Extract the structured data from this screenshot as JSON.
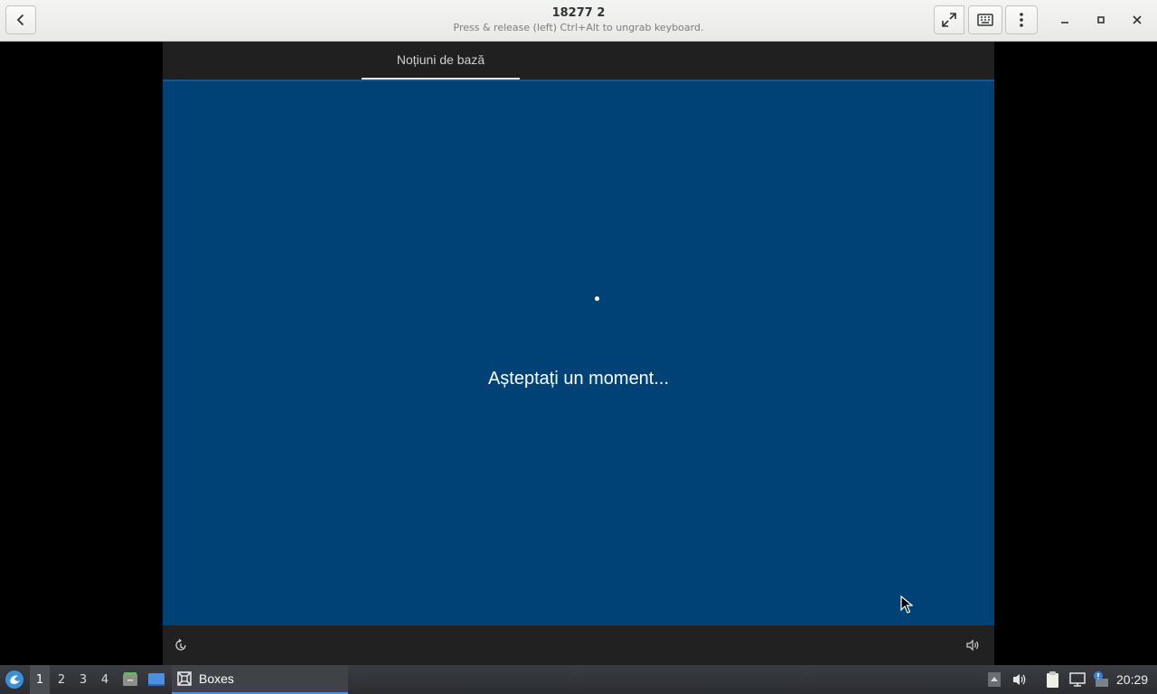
{
  "window": {
    "title": "18277 2",
    "subtitle": "Press & release (left) Ctrl+Alt to ungrab keyboard."
  },
  "vm": {
    "tab_label": "Noțiuni de bază",
    "wait_message": "Așteptați un moment..."
  },
  "taskbar": {
    "workspaces": [
      "1",
      "2",
      "3",
      "4"
    ],
    "active_workspace": "1",
    "task_label": "Boxes",
    "clock": "20:29"
  },
  "colors": {
    "vm_background": "#004275",
    "accent": "#4a90d9"
  },
  "icons": {
    "back": "back-icon",
    "fullscreen": "fullscreen-icon",
    "keyboard": "keyboard-icon",
    "menu": "kebab-menu-icon",
    "ease_of_access": "ease-of-access-icon",
    "volume": "volume-icon"
  }
}
